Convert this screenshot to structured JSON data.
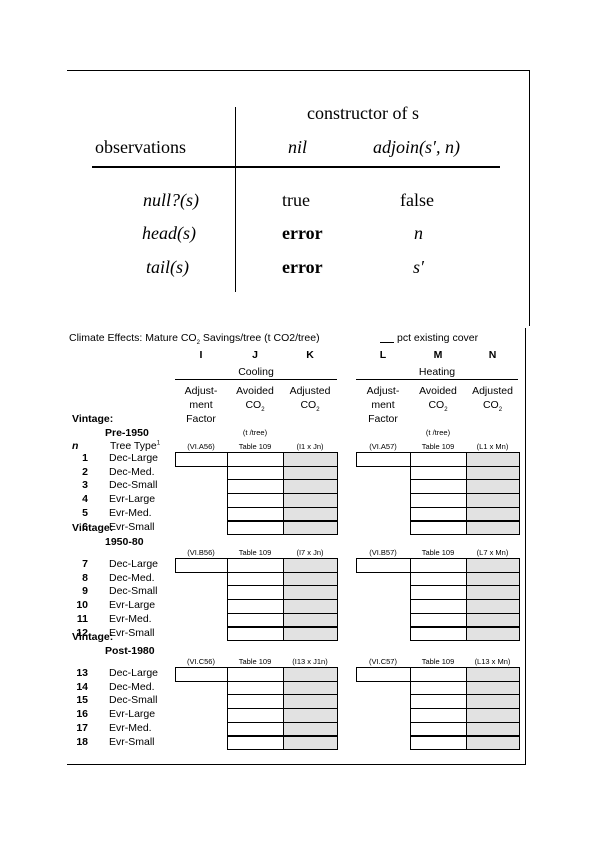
{
  "top_table": {
    "constructor_header": "constructor of s",
    "observations_header": "observations",
    "col_nil": "nil",
    "col_adjoin": "adjoin(s′, n)",
    "rows": [
      {
        "obs": "null?(s)",
        "nil": "true",
        "adjoin": "false"
      },
      {
        "obs": "head(s)",
        "nil": "error",
        "adjoin": "n"
      },
      {
        "obs": "tail(s)",
        "nil": "error",
        "adjoin": "s′"
      }
    ]
  },
  "worksheet": {
    "title_pre": "Climate Effects: Mature CO",
    "title_sub": "2",
    "title_post": " Savings/tree (t CO2/tree)",
    "cover_label": "pct existing cover",
    "col_letters": [
      "I",
      "J",
      "K",
      "L",
      "M",
      "N"
    ],
    "cooling_label": "Cooling",
    "heating_label": "Heating",
    "col_headers": [
      {
        "l1": "Adjust-",
        "l2": "ment",
        "l3": "Factor"
      },
      {
        "l1": "Avoided",
        "l2": "CO",
        "sub": "2"
      },
      {
        "l1": "Adjusted",
        "l2": "CO",
        "sub": "2"
      },
      {
        "l1": "Adjust-",
        "l2": "ment",
        "l3": "Factor"
      },
      {
        "l1": "Avoided",
        "l2": "CO",
        "sub": "2"
      },
      {
        "l1": "Adjusted",
        "l2": "CO",
        "sub": "2"
      }
    ],
    "unit_j": "(t /tree)",
    "unit_m": "(t /tree)",
    "n_label": "n",
    "tree_type_label": "Tree Type",
    "tree_type_sup": "1",
    "vintage_label": "Vintage:",
    "sections": [
      {
        "name": "Pre-1950",
        "refs": [
          "(VI.A56)",
          "Table 109",
          "(I1 x Jn)",
          "(VI.A57)",
          "Table 109",
          "(L1 x Mn)"
        ],
        "rows": [
          {
            "n": "1",
            "type": "Dec-Large"
          },
          {
            "n": "2",
            "type": "Dec-Med."
          },
          {
            "n": "3",
            "type": "Dec-Small"
          },
          {
            "n": "4",
            "type": "Evr-Large"
          },
          {
            "n": "5",
            "type": "Evr-Med."
          },
          {
            "n": "6",
            "type": "Evr-Small"
          }
        ]
      },
      {
        "name": "1950-80",
        "refs": [
          "(VI.B56)",
          "Table 109",
          "(I7 x Jn)",
          "(VI.B57)",
          "Table 109",
          "(L7 x Mn)"
        ],
        "rows": [
          {
            "n": "7",
            "type": "Dec-Large"
          },
          {
            "n": "8",
            "type": "Dec-Med."
          },
          {
            "n": "9",
            "type": "Dec-Small"
          },
          {
            "n": "10",
            "type": "Evr-Large"
          },
          {
            "n": "11",
            "type": "Evr-Med."
          },
          {
            "n": "12",
            "type": "Evr-Small"
          }
        ]
      },
      {
        "name": "Post-1980",
        "refs": [
          "(VI.C56)",
          "Table 109",
          "(I13 x J1n)",
          "(VI.C57)",
          "Table 109",
          "(L13 x Mn)"
        ],
        "rows": [
          {
            "n": "13",
            "type": "Dec-Large"
          },
          {
            "n": "14",
            "type": "Dec-Med."
          },
          {
            "n": "15",
            "type": "Dec-Small"
          },
          {
            "n": "16",
            "type": "Evr-Large"
          },
          {
            "n": "17",
            "type": "Evr-Med."
          },
          {
            "n": "18",
            "type": "Evr-Small"
          }
        ]
      }
    ]
  }
}
